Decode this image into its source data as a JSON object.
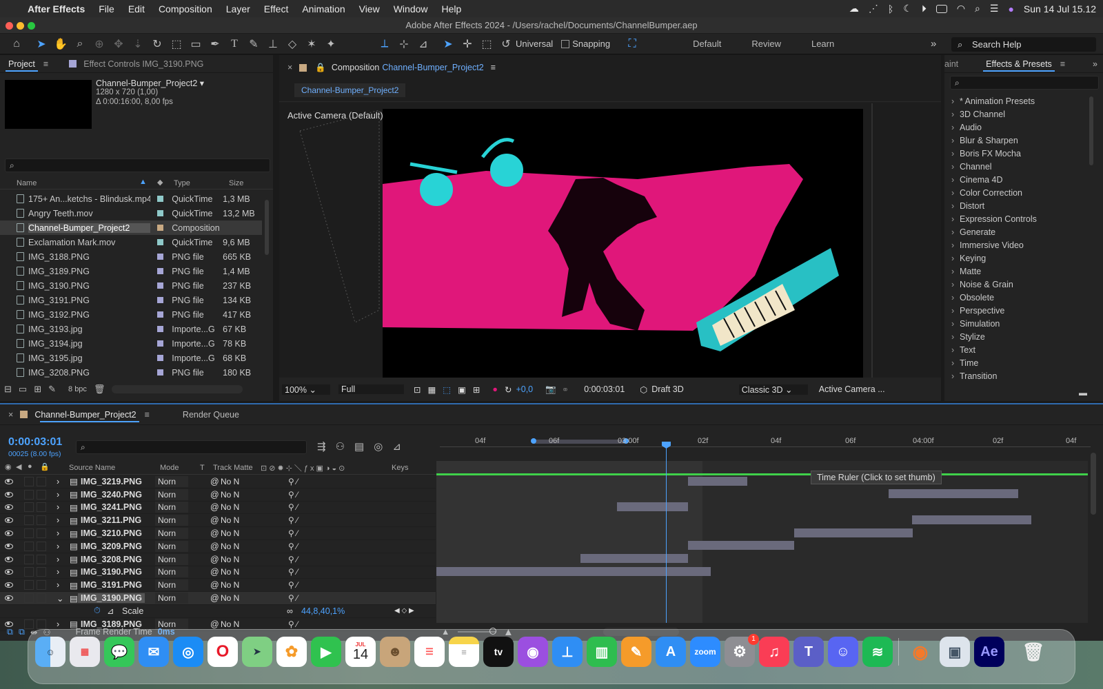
{
  "menubar": {
    "app": "After Effects",
    "items": [
      "File",
      "Edit",
      "Composition",
      "Layer",
      "Effect",
      "Animation",
      "View",
      "Window",
      "Help"
    ],
    "clock": "Sun 14 Jul  15.12"
  },
  "window": {
    "title": "Adobe After Effects 2024 - /Users/rachel/Documents/ChannelBumper.aep"
  },
  "toolbar": {
    "universal": "Universal",
    "snapping": "Snapping",
    "workspaces": [
      "Default",
      "Review",
      "Learn"
    ],
    "search_placeholder": "Search Help"
  },
  "project": {
    "tab": "Project",
    "effect_controls_tab": "Effect Controls IMG_3190.PNG",
    "comp_name": "Channel-Bumper_Project2 ▾",
    "comp_dims": "1280 x 720 (1,00)",
    "comp_duration": "Δ 0:00:16:00, 8,00 fps",
    "headers": {
      "name": "Name",
      "type": "Type",
      "size": "Size"
    },
    "files": [
      {
        "name": "175+ An...ketchs - Blindusk.mp4",
        "type": "QuickTime",
        "size": "1,3 MB",
        "label": "#8fc9c9"
      },
      {
        "name": "Angry Teeth.mov",
        "type": "QuickTime",
        "size": "13,2 MB",
        "label": "#8fc9c9"
      },
      {
        "name": "Channel-Bumper_Project2",
        "type": "Composition",
        "size": "",
        "label": "#c8a982"
      },
      {
        "name": "Exclamation Mark.mov",
        "type": "QuickTime",
        "size": "9,6 MB",
        "label": "#8fc9c9"
      },
      {
        "name": "IMG_3188.PNG",
        "type": "PNG file",
        "size": "665 KB",
        "label": "#a6a6d6"
      },
      {
        "name": "IMG_3189.PNG",
        "type": "PNG file",
        "size": "1,4 MB",
        "label": "#a6a6d6"
      },
      {
        "name": "IMG_3190.PNG",
        "type": "PNG file",
        "size": "237 KB",
        "label": "#a6a6d6"
      },
      {
        "name": "IMG_3191.PNG",
        "type": "PNG file",
        "size": "134 KB",
        "label": "#a6a6d6"
      },
      {
        "name": "IMG_3192.PNG",
        "type": "PNG file",
        "size": "417 KB",
        "label": "#a6a6d6"
      },
      {
        "name": "IMG_3193.jpg",
        "type": "Importe...G",
        "size": "67 KB",
        "label": "#a6a6d6"
      },
      {
        "name": "IMG_3194.jpg",
        "type": "Importe...G",
        "size": "78 KB",
        "label": "#a6a6d6"
      },
      {
        "name": "IMG_3195.jpg",
        "type": "Importe...G",
        "size": "68 KB",
        "label": "#a6a6d6"
      },
      {
        "name": "IMG_3208.PNG",
        "type": "PNG file",
        "size": "180 KB",
        "label": "#a6a6d6"
      }
    ],
    "bpc": "8 bpc"
  },
  "composition": {
    "tab_prefix": "Composition",
    "tab_name": "Channel-Bumper_Project2",
    "breadcrumb": "Channel-Bumper_Project2",
    "camera_label": "Active Camera (Default)",
    "zoom": "100%",
    "resolution": "Full",
    "exposure": "+0,0",
    "timecode": "0:00:03:01",
    "renderer": "Draft 3D",
    "view_renderer": "Classic 3D",
    "camera_menu": "Active Camera ..."
  },
  "effects": {
    "cut_tab": "aint",
    "tab": "Effects & Presets",
    "items": [
      "* Animation Presets",
      "3D Channel",
      "Audio",
      "Blur & Sharpen",
      "Boris FX Mocha",
      "Channel",
      "Cinema 4D",
      "Color Correction",
      "Distort",
      "Expression Controls",
      "Generate",
      "Immersive Video",
      "Keying",
      "Matte",
      "Noise & Grain",
      "Obsolete",
      "Perspective",
      "Simulation",
      "Stylize",
      "Text",
      "Time",
      "Transition"
    ]
  },
  "timeline": {
    "comp_tab": "Channel-Bumper_Project2",
    "render_tab": "Render Queue",
    "timecode": "0:00:03:01",
    "frame_info": "00025 (8.00 fps)",
    "headers": {
      "source": "Source Name",
      "mode": "Mode",
      "t": "T",
      "track_matte": "Track Matte",
      "keys": "Keys"
    },
    "ticks": [
      "04f",
      "06f",
      "03:00f",
      "02f",
      "04f",
      "06f",
      "04:00f",
      "02f",
      "04f"
    ],
    "tooltip": "Time Ruler (Click to set thumb)",
    "layers": [
      {
        "name": "IMG_3219.PNG",
        "mode": "Norn",
        "matte": "No N"
      },
      {
        "name": "IMG_3240.PNG",
        "mode": "Norn",
        "matte": "No N"
      },
      {
        "name": "IMG_3241.PNG",
        "mode": "Norn",
        "matte": "No N"
      },
      {
        "name": "IMG_3211.PNG",
        "mode": "Norn",
        "matte": "No N"
      },
      {
        "name": "IMG_3210.PNG",
        "mode": "Norn",
        "matte": "No N"
      },
      {
        "name": "IMG_3209.PNG",
        "mode": "Norn",
        "matte": "No N"
      },
      {
        "name": "IMG_3208.PNG",
        "mode": "Norn",
        "matte": "No N"
      },
      {
        "name": "IMG_3190.PNG",
        "mode": "Norn",
        "matte": "No N"
      },
      {
        "name": "IMG_3191.PNG",
        "mode": "Norn",
        "matte": "No N"
      },
      {
        "name": "IMG_3190.PNG",
        "mode": "Norn",
        "matte": "No N"
      },
      {
        "prop": "Scale",
        "value": "44,8,40,1%"
      },
      {
        "name": "IMG_3189.PNG",
        "mode": "Norn",
        "matte": "No N"
      }
    ],
    "frame_render_label": "Frame Render Time",
    "frame_render_value": "0ms"
  },
  "dock": {
    "calendar_month": "JUL",
    "calendar_day": "14",
    "settings_badge": "1",
    "zoom_label": "zoom",
    "ae_label": "Ae"
  },
  "colors": {
    "accent": "#4da3ff",
    "magenta": "#e0177a",
    "cyan": "#28d3d6"
  }
}
